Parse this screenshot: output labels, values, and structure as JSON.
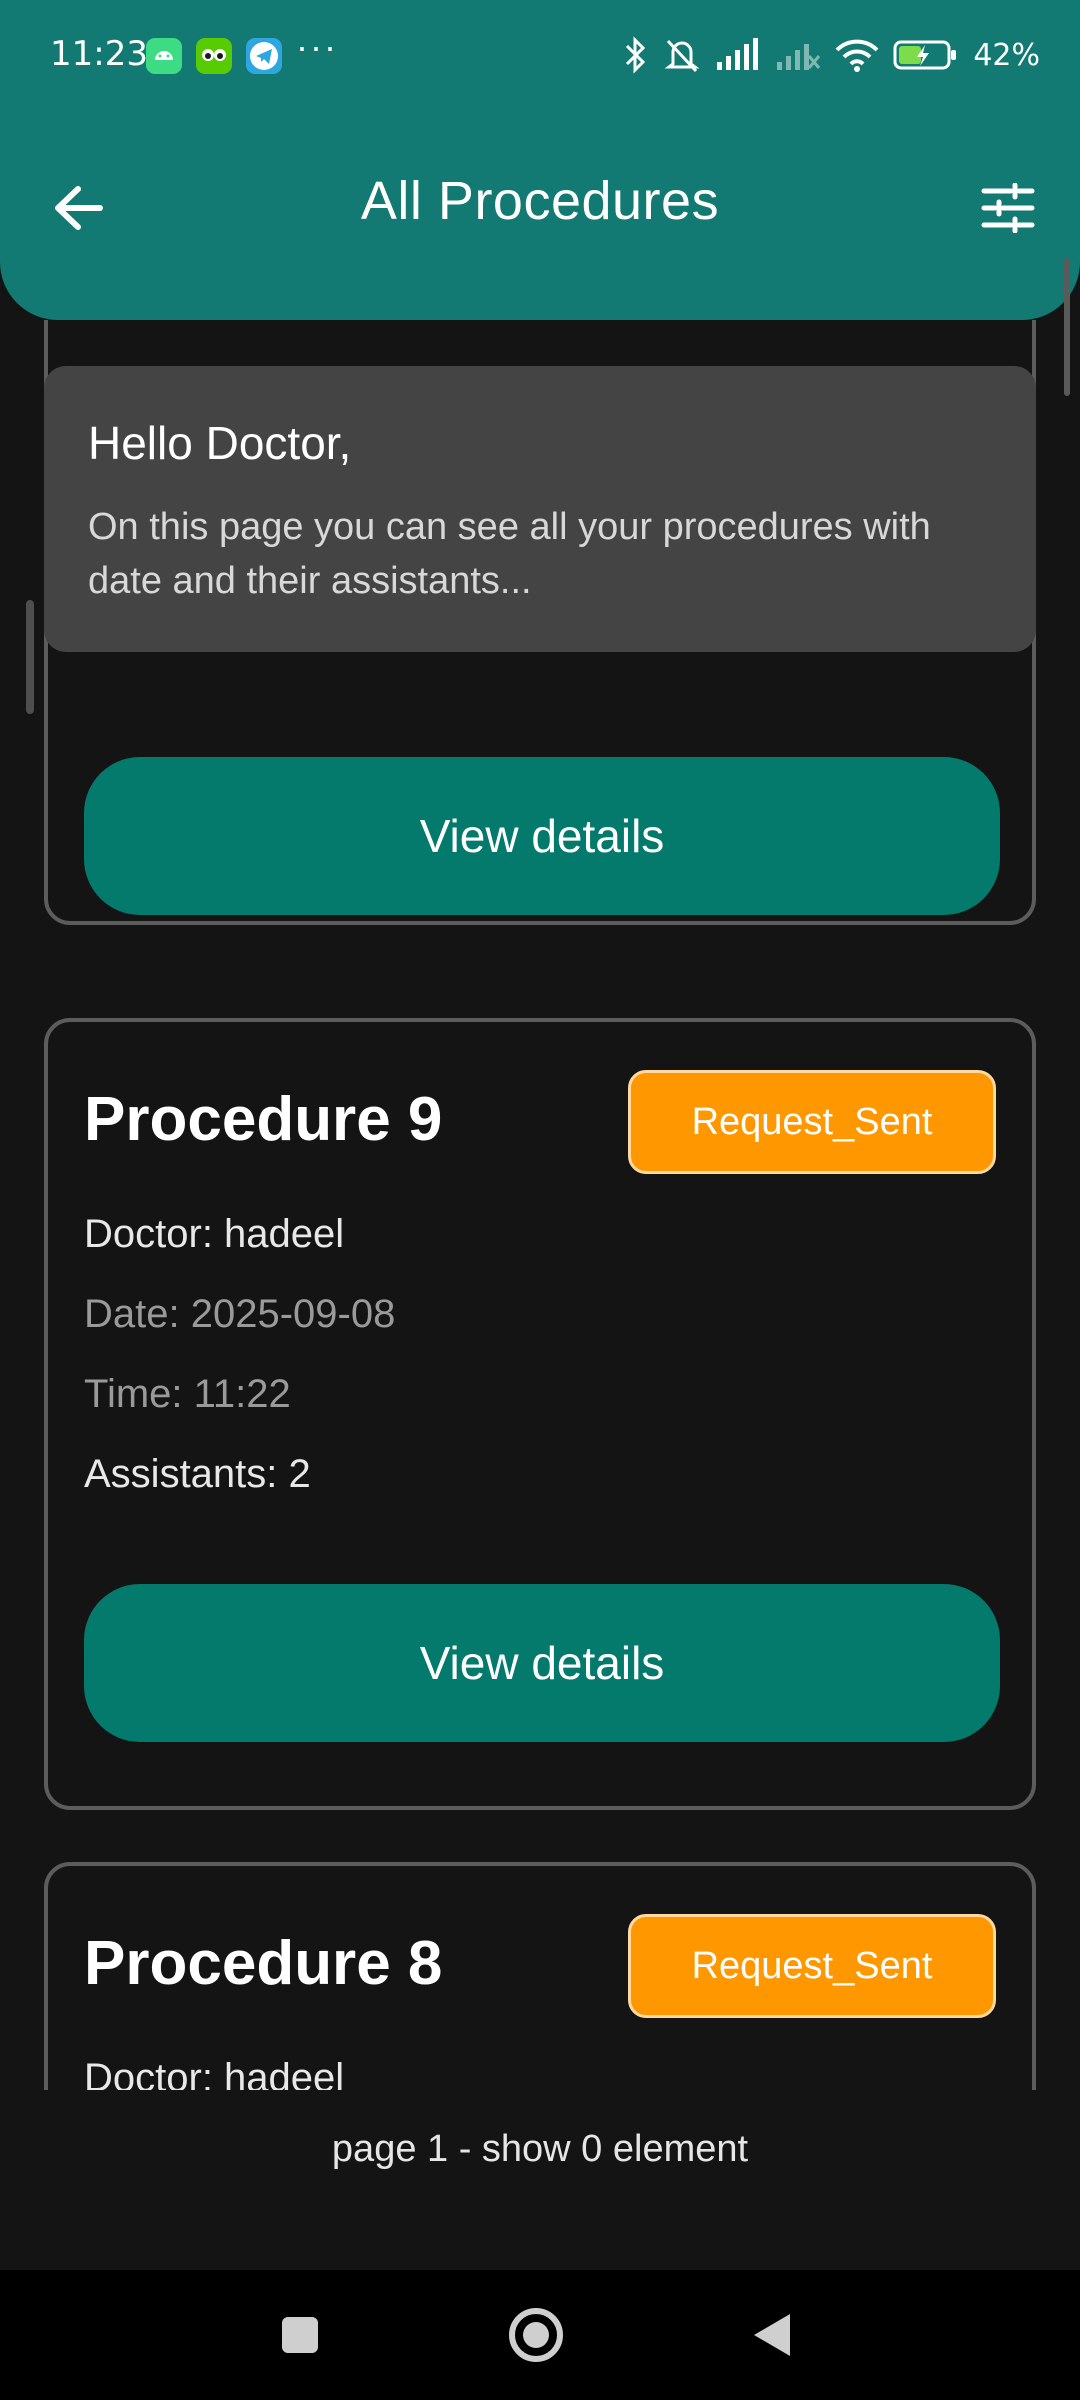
{
  "status_bar": {
    "time": "11:23",
    "battery": "42%",
    "icons": [
      "android-icon",
      "duolingo-icon",
      "telegram-icon",
      "more-icon",
      "bluetooth-icon",
      "mute-icon",
      "signal-icon",
      "signal-off-icon",
      "wifi-icon",
      "battery-charging-icon"
    ]
  },
  "app_bar": {
    "title": "All Procedures",
    "back_icon": "arrow-left-icon",
    "filter_icon": "tune-icon"
  },
  "greeting": {
    "heading": "Hello Doctor,",
    "body": "On this page you can see all your procedures with date and their assistants..."
  },
  "procedures": [
    {
      "title": "",
      "view_label": "View details"
    },
    {
      "title": "Procedure 9",
      "status": "Request_Sent",
      "doctor": "Doctor: hadeel",
      "date": "Date: 2025-09-08",
      "time": "Time: 11:22",
      "assistants": "Assistants: 2",
      "view_label": "View details"
    },
    {
      "title": "Procedure 8",
      "status": "Request_Sent",
      "doctor": "Doctor: hadeel"
    }
  ],
  "pager": {
    "text": "page  1 - show 0 element"
  },
  "colors": {
    "app_bar": "#127A72",
    "button": "#037A6C",
    "badge": "#FF9800",
    "background": "#141414",
    "banner": "#444444"
  },
  "nav_bar": {
    "icons": [
      "recents-icon",
      "home-icon",
      "back-icon"
    ]
  }
}
